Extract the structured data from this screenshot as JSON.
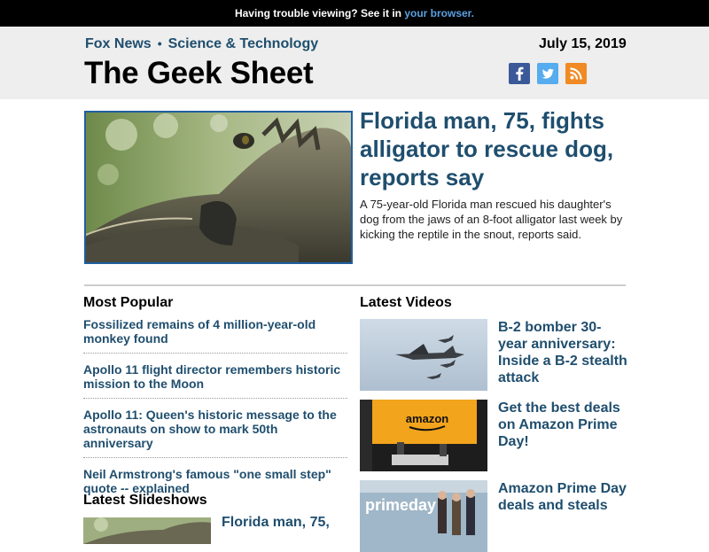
{
  "topbar": {
    "text": "Having trouble viewing? See it in",
    "link": "your browser."
  },
  "masthead": {
    "section_1": "Fox News",
    "separator": "•",
    "section_2": "Science & Technology",
    "title": "The Geek Sheet",
    "date": "July 15, 2019",
    "social_icons": [
      "facebook-icon",
      "twitter-icon",
      "rss-icon"
    ]
  },
  "hero": {
    "title": "Florida man, 75, fights alligator to rescue dog, reports say",
    "summary": "A 75-year-old Florida man rescued his daughter's dog from the jaws of an 8-foot alligator last week by kicking the reptile in the snout, reports said."
  },
  "most_popular": {
    "heading": "Most Popular",
    "items": [
      "Fossilized remains of 4 million-year-old monkey found",
      "Apollo 11 flight director remembers historic mission to the Moon",
      "Apollo 11: Queen's historic message to the astronauts on show to mark 50th anniversary",
      "Neil Armstrong's famous \"one small step\" quote -- explained"
    ]
  },
  "latest_videos": {
    "heading": "Latest Videos",
    "items": [
      "B-2 bomber 30-year anniversary: Inside a B-2 stealth attack",
      "Get the best deals on Amazon Prime Day!",
      "Amazon Prime Day deals and steals"
    ]
  },
  "latest_slideshows": {
    "heading": "Latest Slideshows",
    "items": [
      "Florida man, 75,"
    ]
  },
  "thumb_text": {
    "amazon": "amazon",
    "primeday": "primeday"
  },
  "colors": {
    "headline": "#1f4e6e",
    "link": "#5aa0e0",
    "masthead_bg": "#eeeeee"
  }
}
